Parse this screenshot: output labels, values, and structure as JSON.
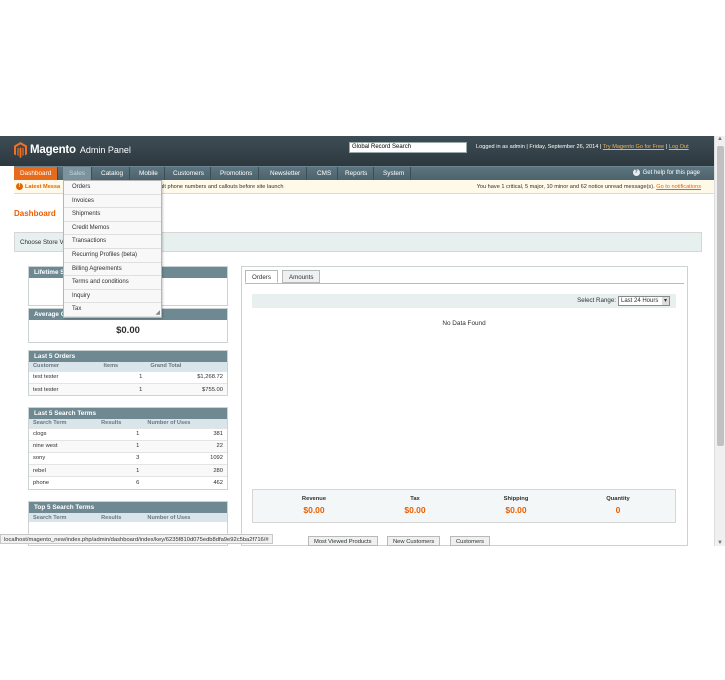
{
  "header": {
    "logo_text": "Magento",
    "logo_sub": "Admin Panel",
    "search_value": "Global Record Search",
    "logged_in": "Logged in as admin",
    "date": "Friday, September 26, 2014",
    "try_go": "Try Magento Go for Free",
    "logout": "Log Out"
  },
  "nav": {
    "items": [
      "Dashboard",
      "Sales",
      "Catalog",
      "Mobile",
      "Customers",
      "Promotions",
      "Newsletter",
      "CMS",
      "Reports",
      "System"
    ],
    "help": "Get help for this page"
  },
  "messages": {
    "latest_label": "Latest Messa",
    "latest_text": "ult phone numbers and callouts before site launch",
    "summary_pre": "You have",
    "critical": "1 critical",
    "major": "5 major",
    "minor": "10 minor",
    "notice": "62 notice unread message(s).",
    "summary_full": "You have 1 critical, 5 major, 10 minor and 62 notice unread message(s).",
    "goto": "Go to notifications"
  },
  "sales_menu": [
    "Orders",
    "Invoices",
    "Shipments",
    "Credit Memos",
    "Transactions",
    "Recurring Profiles (beta)",
    "Billing Agreements",
    "Terms and conditions",
    "Inquiry",
    "Tax"
  ],
  "page": {
    "title": "Dashboard",
    "store_label": "Choose Store V"
  },
  "lifetime": {
    "title": "Lifetime S"
  },
  "average": {
    "title": "Average O",
    "value": "$0.00"
  },
  "last_orders": {
    "title": "Last 5 Orders",
    "columns": [
      "Customer",
      "Items",
      "Grand Total"
    ],
    "rows": [
      [
        "test tester",
        "1",
        "$1,268.72"
      ],
      [
        "test tester",
        "1",
        "$755.00"
      ]
    ]
  },
  "last_search": {
    "title": "Last 5 Search Terms",
    "columns": [
      "Search Term",
      "Results",
      "Number of Uses"
    ],
    "rows": [
      [
        "clogs",
        "1",
        "381"
      ],
      [
        "nine west",
        "1",
        "22"
      ],
      [
        "sony",
        "3",
        "1092"
      ],
      [
        "rebel",
        "1",
        "280"
      ],
      [
        "phone",
        "6",
        "462"
      ]
    ]
  },
  "top_search": {
    "title": "Top 5 Search Terms",
    "columns": [
      "Search Term",
      "Results",
      "Number of Uses"
    ]
  },
  "chart_panel": {
    "tabs": [
      "Orders",
      "Amounts"
    ],
    "range_label": "Select Range:",
    "range_value": "Last 24 Hours",
    "no_data": "No Data Found"
  },
  "totals": [
    {
      "label": "Revenue",
      "value": "$0.00"
    },
    {
      "label": "Tax",
      "value": "$0.00"
    },
    {
      "label": "Shipping",
      "value": "$0.00"
    },
    {
      "label": "Quantity",
      "value": "0"
    }
  ],
  "bottom_tabs": [
    "Most Viewed Products",
    "New Customers",
    "Customers"
  ],
  "status_url": "localhost/magento_new/index.php/admin/dashboard/index/key/6235f810d075edb8dfa9e92c5ba2f716/#",
  "colors": {
    "accent": "#eb5e00",
    "header": "#2d383e",
    "nav": "#4c626c",
    "box_header": "#6f8992"
  }
}
